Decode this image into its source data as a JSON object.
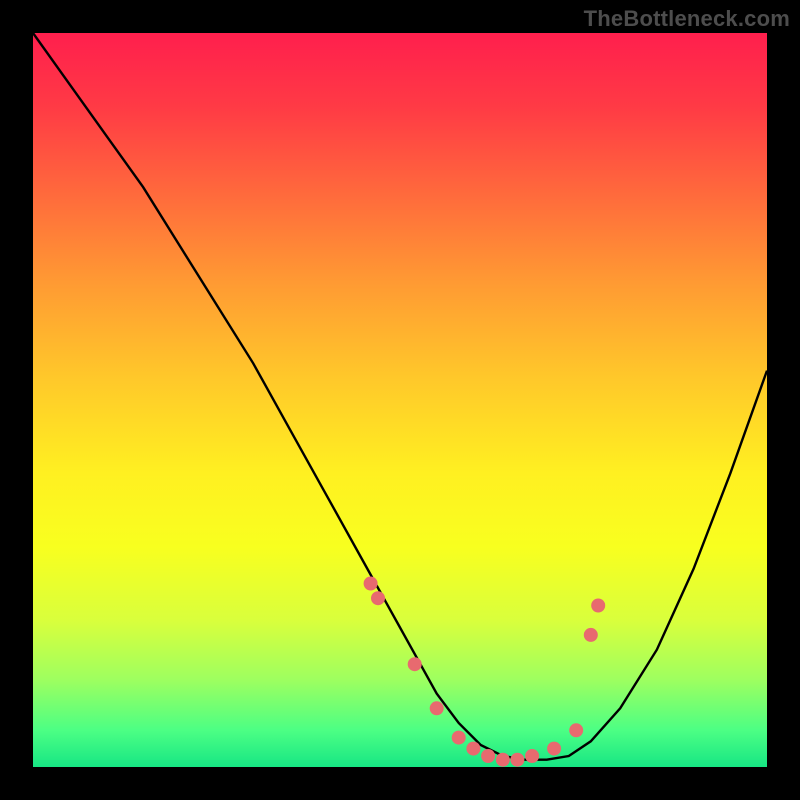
{
  "watermark": "TheBottleneck.com",
  "chart_data": {
    "type": "line",
    "title": "",
    "xlabel": "",
    "ylabel": "",
    "xlim": [
      0,
      100
    ],
    "ylim": [
      0,
      100
    ],
    "series": [
      {
        "name": "curve",
        "x": [
          0,
          5,
          10,
          15,
          20,
          25,
          30,
          35,
          40,
          45,
          50,
          55,
          58,
          61,
          64,
          67,
          70,
          73,
          76,
          80,
          85,
          90,
          95,
          100
        ],
        "values": [
          100,
          93,
          86,
          79,
          71,
          63,
          55,
          46,
          37,
          28,
          19,
          10,
          6,
          3,
          1.5,
          1,
          1,
          1.5,
          3.5,
          8,
          16,
          27,
          40,
          54
        ]
      },
      {
        "name": "markers",
        "x": [
          46,
          47,
          52,
          55,
          58,
          60,
          62,
          64,
          66,
          68,
          71,
          74,
          76,
          77
        ],
        "values": [
          25,
          23,
          14,
          8,
          4,
          2.5,
          1.5,
          1,
          1,
          1.5,
          2.5,
          5,
          18,
          22
        ]
      }
    ],
    "colors": {
      "curve": "#000000",
      "markers": "#e86a6f",
      "gradient_top": "#ff1f4d",
      "gradient_bottom": "#17e684"
    }
  }
}
